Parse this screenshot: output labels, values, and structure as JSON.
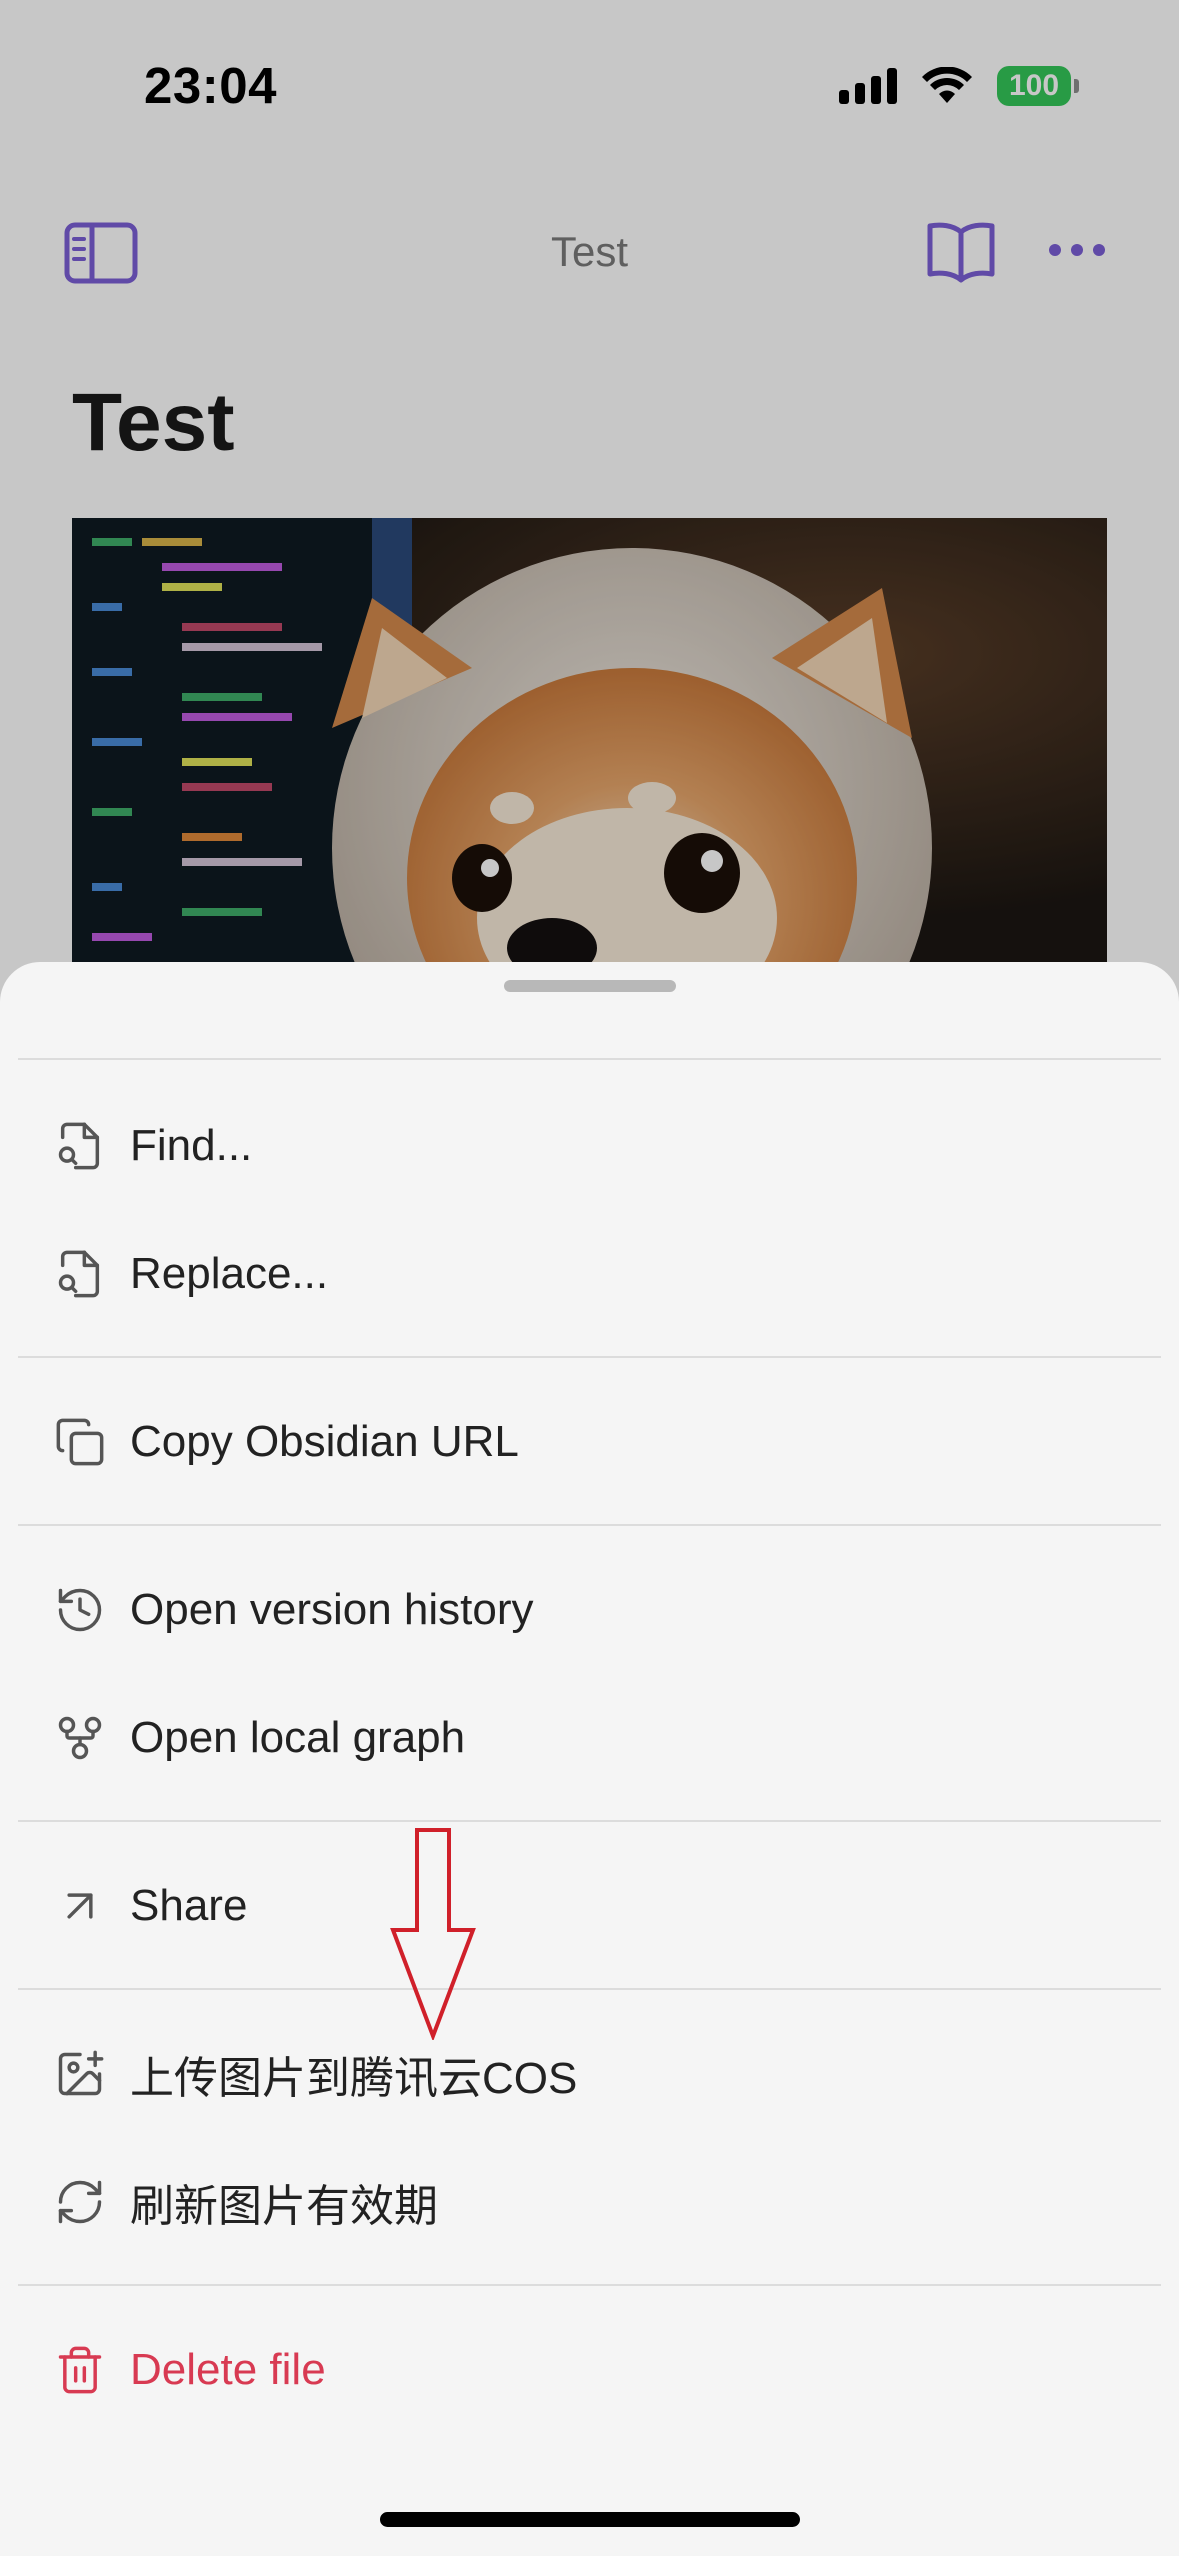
{
  "status_bar": {
    "time": "23:04",
    "battery": "100"
  },
  "nav": {
    "title": "Test"
  },
  "note": {
    "title": "Test"
  },
  "menu": {
    "items": [
      {
        "label": "Find...",
        "icon": "file-search-icon"
      },
      {
        "label": "Replace...",
        "icon": "file-search-icon"
      },
      {
        "label": "Copy Obsidian URL",
        "icon": "copy-icon"
      },
      {
        "label": "Open version history",
        "icon": "history-icon"
      },
      {
        "label": "Open local graph",
        "icon": "git-fork-icon"
      },
      {
        "label": "Share",
        "icon": "arrow-up-right-icon"
      },
      {
        "label": "上传图片到腾讯云COS",
        "icon": "image-plus-icon"
      },
      {
        "label": "刷新图片有效期",
        "icon": "refresh-icon"
      },
      {
        "label": "Delete file",
        "icon": "trash-icon"
      }
    ]
  },
  "colors": {
    "accent": "#7b5fd6",
    "danger": "#d83a52",
    "annotation": "#d0202a",
    "battery": "#34c759"
  }
}
